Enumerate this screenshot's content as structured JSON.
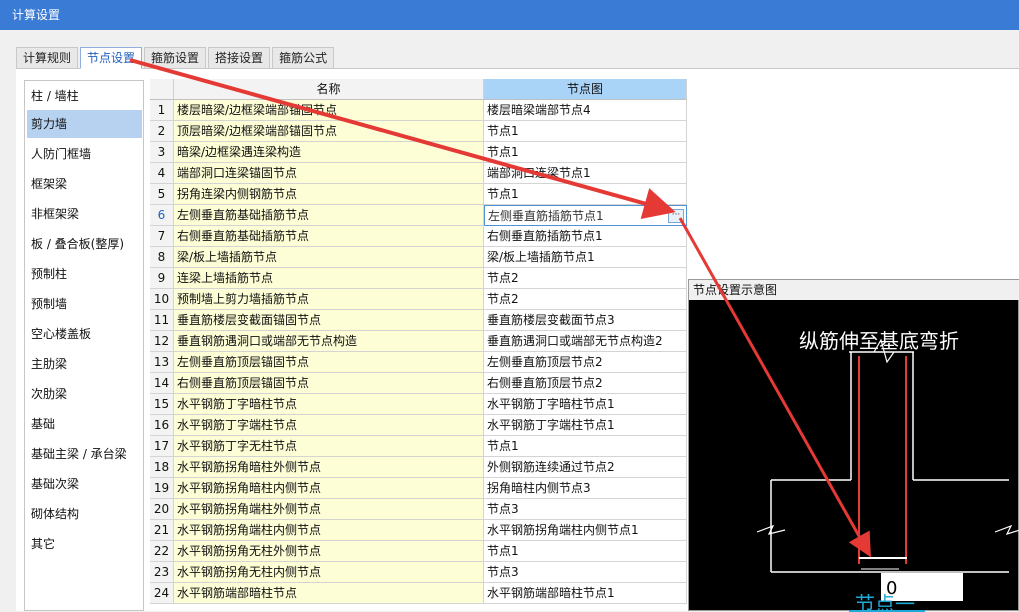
{
  "window": {
    "title": "计算设置"
  },
  "tabs": [
    "计算规则",
    "节点设置",
    "箍筋设置",
    "搭接设置",
    "箍筋公式"
  ],
  "sidebar": [
    "柱 / 墙柱",
    "剪力墙",
    "人防门框墙",
    "框架梁",
    "非框架梁",
    "板 / 叠合板(整厚)",
    "预制柱",
    "预制墙",
    "空心楼盖板",
    "主肋梁",
    "次肋梁",
    "基础",
    "基础主梁 / 承台梁",
    "基础次梁",
    "砌体结构",
    "其它"
  ],
  "grid": {
    "headers": {
      "name": "名称",
      "node": "节点图"
    },
    "rows": [
      {
        "num": "1",
        "name": "楼层暗梁/边框梁端部锚固节点",
        "node": "楼层暗梁端部节点4"
      },
      {
        "num": "2",
        "name": "顶层暗梁/边框梁端部锚固节点",
        "node": "节点1"
      },
      {
        "num": "3",
        "name": "暗梁/边框梁遇连梁构造",
        "node": "节点1"
      },
      {
        "num": "4",
        "name": "端部洞口连梁锚固节点",
        "node": "端部洞口连梁节点1"
      },
      {
        "num": "5",
        "name": "拐角连梁内侧钢筋节点",
        "node": "节点1"
      },
      {
        "num": "6",
        "name": "左侧垂直筋基础插筋节点",
        "node": "左侧垂直筋插筋节点1"
      },
      {
        "num": "7",
        "name": "右侧垂直筋基础插筋节点",
        "node": "右侧垂直筋插筋节点1"
      },
      {
        "num": "8",
        "name": "梁/板上墙插筋节点",
        "node": "梁/板上墙插筋节点1"
      },
      {
        "num": "9",
        "name": "连梁上墙插筋节点",
        "node": "节点2"
      },
      {
        "num": "10",
        "name": "预制墙上剪力墙插筋节点",
        "node": "节点2"
      },
      {
        "num": "11",
        "name": "垂直筋楼层变截面锚固节点",
        "node": "垂直筋楼层变截面节点3"
      },
      {
        "num": "12",
        "name": "垂直钢筋遇洞口或端部无节点构造",
        "node": "垂直筋遇洞口或端部无节点构造2"
      },
      {
        "num": "13",
        "name": "左侧垂直筋顶层锚固节点",
        "node": "左侧垂直筋顶层节点2"
      },
      {
        "num": "14",
        "name": "右侧垂直筋顶层锚固节点",
        "node": "右侧垂直筋顶层节点2"
      },
      {
        "num": "15",
        "name": "水平钢筋丁字暗柱节点",
        "node": "水平钢筋丁字暗柱节点1"
      },
      {
        "num": "16",
        "name": "水平钢筋丁字端柱节点",
        "node": "水平钢筋丁字端柱节点1"
      },
      {
        "num": "17",
        "name": "水平钢筋丁字无柱节点",
        "node": "节点1"
      },
      {
        "num": "18",
        "name": "水平钢筋拐角暗柱外侧节点",
        "node": "外侧钢筋连续通过节点2"
      },
      {
        "num": "19",
        "name": "水平钢筋拐角暗柱内侧节点",
        "node": "拐角暗柱内侧节点3"
      },
      {
        "num": "20",
        "name": "水平钢筋拐角端柱外侧节点",
        "node": "节点3"
      },
      {
        "num": "21",
        "name": "水平钢筋拐角端柱内侧节点",
        "node": "水平钢筋拐角端柱内侧节点1"
      },
      {
        "num": "22",
        "name": "水平钢筋拐角无柱外侧节点",
        "node": "节点1"
      },
      {
        "num": "23",
        "name": "水平钢筋拐角无柱内侧节点",
        "node": "节点3"
      },
      {
        "num": "24",
        "name": "水平钢筋端部暗柱节点",
        "node": "水平钢筋端部暗柱节点1"
      }
    ]
  },
  "preview": {
    "title": "节点设置示意图",
    "caption_top": "纵筋伸至基底弯折",
    "input_value": "0",
    "node_label": "节点一"
  },
  "colors": {
    "accent": "#3a7bd5",
    "arrow": "#e53935",
    "rebar": "#e53935",
    "caption_link": "#1fa9d6"
  }
}
